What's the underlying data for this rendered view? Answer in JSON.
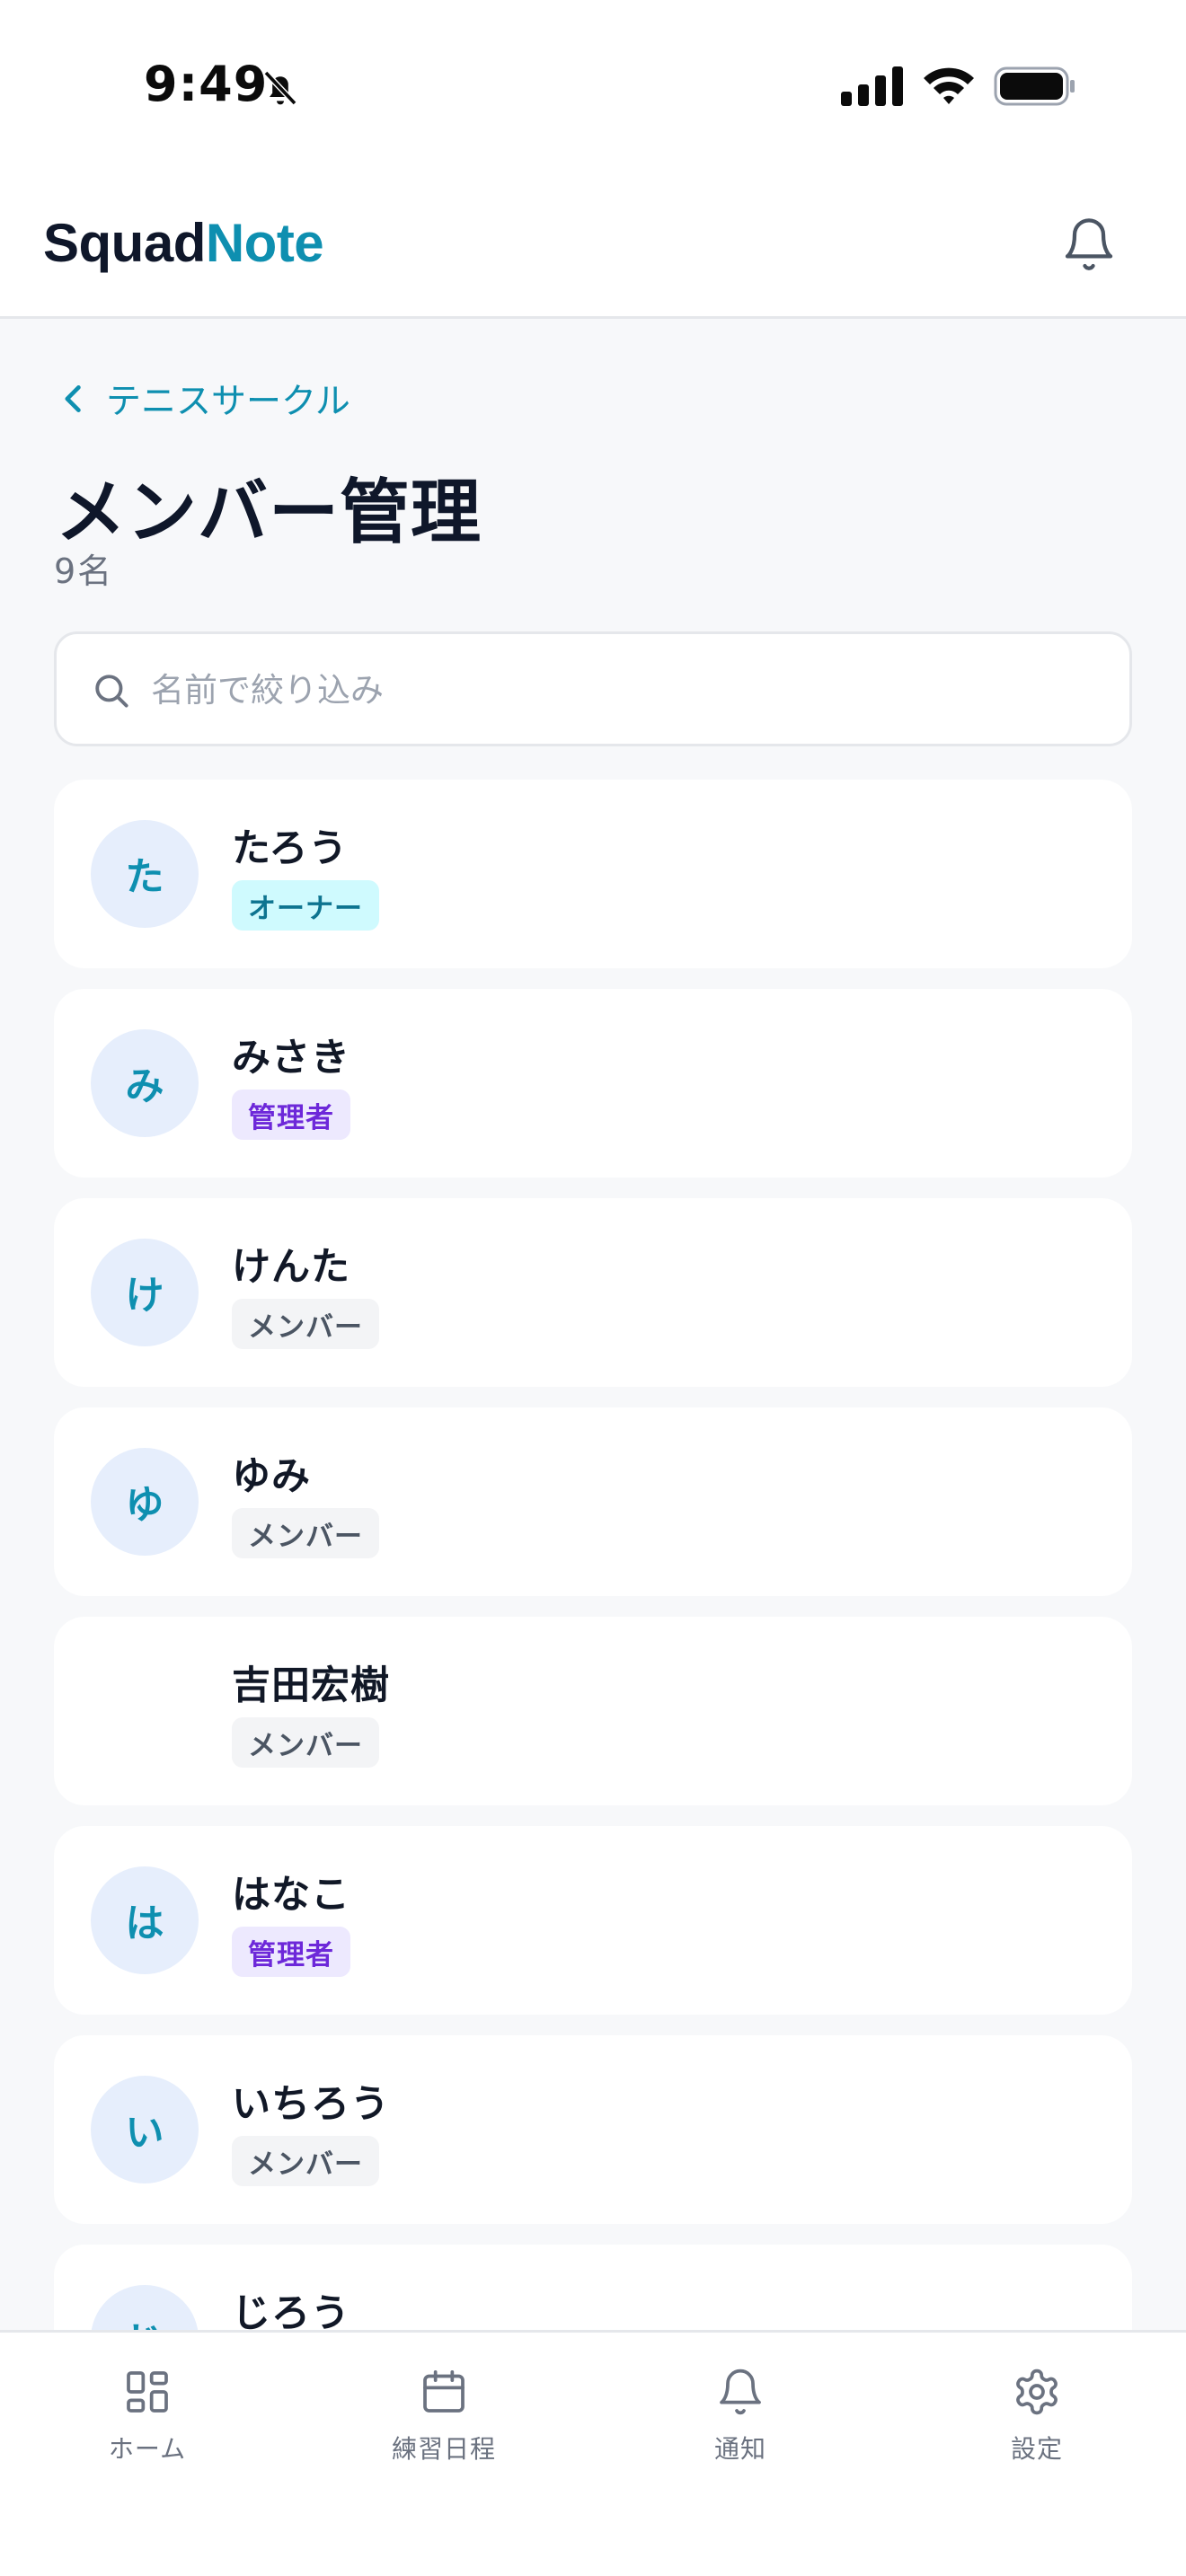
{
  "status_bar": {
    "time": "9:49"
  },
  "header": {
    "brand_part1": "Squad",
    "brand_part2": "Note"
  },
  "breadcrumb": {
    "back_label": "テニスサークル"
  },
  "page": {
    "title": "メンバー管理",
    "member_count": "9名"
  },
  "search": {
    "placeholder": "名前で絞り込み",
    "value": ""
  },
  "members": [
    {
      "initial": "た",
      "name": "たろう",
      "role": "オーナー",
      "role_type": "owner"
    },
    {
      "initial": "み",
      "name": "みさき",
      "role": "管理者",
      "role_type": "admin"
    },
    {
      "initial": "け",
      "name": "けんた",
      "role": "メンバー",
      "role_type": "member"
    },
    {
      "initial": "ゆ",
      "name": "ゆみ",
      "role": "メンバー",
      "role_type": "member"
    },
    {
      "initial": "",
      "name": "吉田宏樹",
      "role": "メンバー",
      "role_type": "member"
    },
    {
      "initial": "は",
      "name": "はなこ",
      "role": "管理者",
      "role_type": "admin"
    },
    {
      "initial": "い",
      "name": "いちろう",
      "role": "メンバー",
      "role_type": "member"
    },
    {
      "initial": "じ",
      "name": "じろう",
      "role": "",
      "role_type": "member"
    }
  ],
  "bottom_nav": [
    {
      "label": "ホーム",
      "icon": "home-grid-icon"
    },
    {
      "label": "練習日程",
      "icon": "calendar-icon"
    },
    {
      "label": "通知",
      "icon": "bell-icon"
    },
    {
      "label": "設定",
      "icon": "gear-icon"
    }
  ],
  "colors": {
    "accent": "#0e8fb0",
    "owner_badge_bg": "#cffafe",
    "admin_badge_bg": "#ede9fe",
    "member_badge_bg": "#f3f4f6"
  }
}
